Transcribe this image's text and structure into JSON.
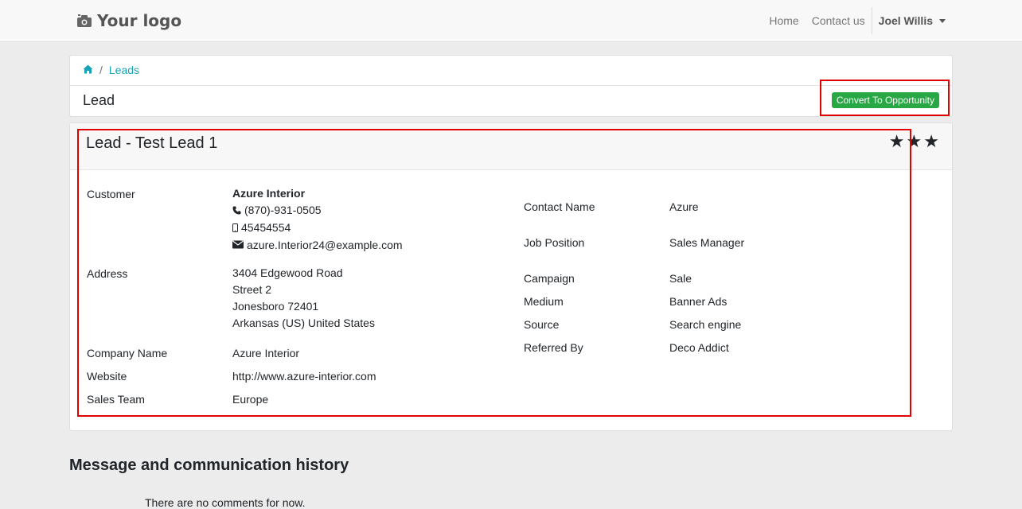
{
  "navbar": {
    "logo_text": "Your logo",
    "links": [
      "Home",
      "Contact us"
    ],
    "user_name": "Joel Willis"
  },
  "breadcrumb": {
    "current": "Leads"
  },
  "page": {
    "title": "Lead",
    "convert_button": "Convert To Opportunity"
  },
  "lead": {
    "title": "Lead - Test Lead 1",
    "priority_stars": 3,
    "left_fields": {
      "customer": {
        "label": "Customer",
        "name": "Azure Interior",
        "phone": "(870)-931-0505",
        "mobile": "45454554",
        "email": "azure.Interior24@example.com"
      },
      "address": {
        "label": "Address",
        "line1": "3404 Edgewood Road",
        "line2": "Street 2",
        "line3": "Jonesboro 72401",
        "line4": "Arkansas (US) United States"
      },
      "company_name": {
        "label": "Company Name",
        "value": "Azure Interior"
      },
      "website": {
        "label": "Website",
        "value": "http://www.azure-interior.com"
      },
      "sales_team": {
        "label": "Sales Team",
        "value": "Europe"
      }
    },
    "right_fields": {
      "contact_name": {
        "label": "Contact Name",
        "value": "Azure"
      },
      "job_position": {
        "label": "Job Position",
        "value": "Sales Manager"
      },
      "campaign": {
        "label": "Campaign",
        "value": "Sale"
      },
      "medium": {
        "label": "Medium",
        "value": "Banner Ads"
      },
      "source": {
        "label": "Source",
        "value": "Search engine"
      },
      "referred_by": {
        "label": "Referred By",
        "value": "Deco Addict"
      }
    }
  },
  "history": {
    "title": "Message and communication history",
    "empty_text": "There are no comments for now."
  },
  "colors": {
    "accent": "#17a2b8",
    "button": "#28a745",
    "highlight": "#e00000"
  }
}
